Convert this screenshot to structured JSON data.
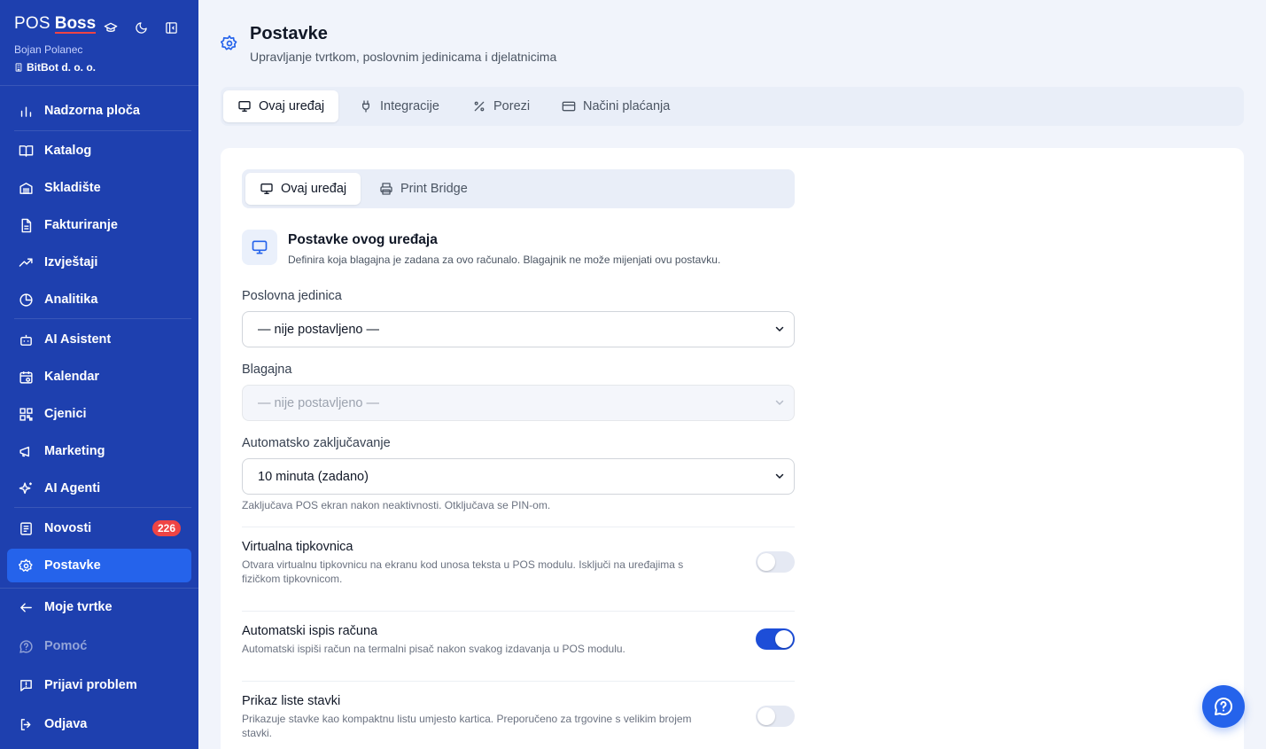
{
  "sidebar": {
    "brand_pos": "POS",
    "brand_boss": "Boss",
    "user_name": "Bojan Polanec",
    "company": "BitBot d. o. o.",
    "items": [
      {
        "label": "Nadzorna ploča",
        "icon": "bar-chart-icon"
      },
      {
        "label": "Katalog",
        "icon": "book-icon"
      },
      {
        "label": "Skladište",
        "icon": "warehouse-icon"
      },
      {
        "label": "Fakturiranje",
        "icon": "document-icon"
      },
      {
        "label": "Izvještaji",
        "icon": "trend-icon"
      },
      {
        "label": "Analitika",
        "icon": "pie-chart-icon"
      },
      {
        "label": "AI Asistent",
        "icon": "bot-icon"
      },
      {
        "label": "Kalendar",
        "icon": "calendar-icon"
      },
      {
        "label": "Cjenici",
        "icon": "qr-icon"
      },
      {
        "label": "Marketing",
        "icon": "megaphone-icon"
      },
      {
        "label": "AI Agenti",
        "icon": "sparkles-icon"
      },
      {
        "label": "Novosti",
        "icon": "news-icon",
        "badge": "226"
      },
      {
        "label": "Postavke",
        "icon": "gear-icon"
      },
      {
        "label": "Moje tvrtke",
        "icon": "arrow-left-icon"
      },
      {
        "label": "Pomoć",
        "icon": "help-icon"
      },
      {
        "label": "Prijavi problem",
        "icon": "report-icon"
      },
      {
        "label": "Odjava",
        "icon": "logout-icon"
      }
    ]
  },
  "header": {
    "title": "Postavke",
    "subtitle": "Upravljanje tvrtkom, poslovnim jedinicama i djelatnicima"
  },
  "tabs": [
    {
      "label": "Ovaj uređaj"
    },
    {
      "label": "Integracije"
    },
    {
      "label": "Porezi"
    },
    {
      "label": "Načini plaćanja"
    }
  ],
  "subtabs": [
    {
      "label": "Ovaj uređaj"
    },
    {
      "label": "Print Bridge"
    }
  ],
  "section": {
    "title": "Postavke ovog uređaja",
    "description": "Definira koja blagajna je zadana za ovo računalo. Blagajnik ne može mijenjati ovu postavku."
  },
  "fields": {
    "unit": {
      "label": "Poslovna jedinica",
      "value": "— nije postavljeno —"
    },
    "register": {
      "label": "Blagajna",
      "value": "— nije postavljeno —"
    },
    "autolock": {
      "label": "Automatsko zaključavanje",
      "value": "10 minuta (zadano)",
      "hint": "Zaključava POS ekran nakon neaktivnosti. Otključava se PIN-om."
    }
  },
  "toggles": {
    "keyboard": {
      "title": "Virtualna tipkovnica",
      "description": "Otvara virtualnu tipkovnicu na ekranu kod unosa teksta u POS modulu. Isključi na uređajima s fizičkom tipkovnicom.",
      "on": false
    },
    "autoprint": {
      "title": "Automatski ispis računa",
      "description": "Automatski ispiši račun na termalni pisač nakon svakog izdavanja u POS modulu.",
      "on": true
    },
    "listview": {
      "title": "Prikaz liste stavki",
      "description": "Prikazuje stavke kao kompaktnu listu umjesto kartica. Preporučeno za trgovine s velikim brojem stavki.",
      "on": false
    }
  },
  "colors": {
    "sidebar": "#1e40af",
    "active": "#2563eb",
    "badge": "#ef4444",
    "toggle_on": "#1d4ed8"
  }
}
